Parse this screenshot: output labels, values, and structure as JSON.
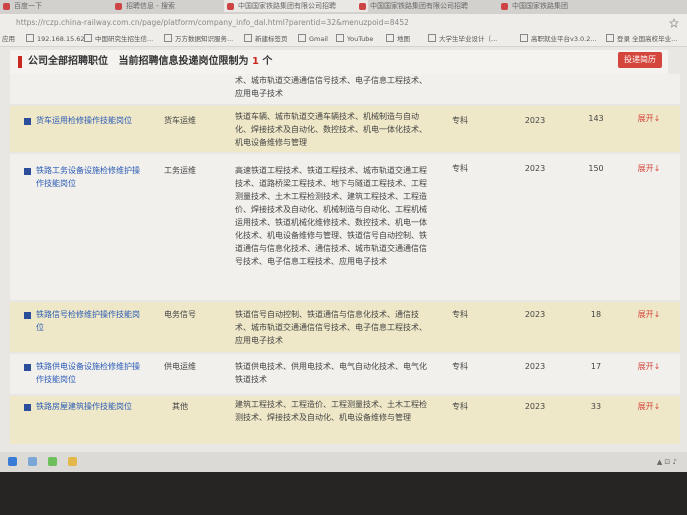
{
  "browser": {
    "tabs": [
      {
        "label": "百度一下"
      },
      {
        "label": "招聘信息 - 搜索"
      },
      {
        "label": "中国国家铁路集团有限公司招聘"
      },
      {
        "label": "中国国家铁路集团有限公司招聘"
      },
      {
        "label": "中国国家铁路集团"
      }
    ],
    "url": "https://rczp.china-railway.com.cn/page/platform/company_info_dal.html?parentid=32&menuzpoid=8452",
    "bookmarks": [
      {
        "label": "应用"
      },
      {
        "label": "192.168.15.62"
      },
      {
        "label": "中国研究生招生信..."
      },
      {
        "label": "万方数据知识服务..."
      },
      {
        "label": "新建标签页"
      },
      {
        "label": "Gmail"
      },
      {
        "label": "YouTube"
      },
      {
        "label": "地图"
      },
      {
        "label": "大学生毕业设计（..."
      },
      {
        "label": "高职就业平台v3.0.2..."
      },
      {
        "label": "登录 全国高校毕业..."
      }
    ]
  },
  "header": {
    "part1": "公司全部招聘职位",
    "part2": "当前招聘信息投递岗位限制为",
    "limit": "1",
    "unit": "个",
    "deliver_label": "投递简历"
  },
  "rows": [
    {
      "name": "",
      "category": "",
      "majors": "术、城市轨道交通通信信号技术、电子信息工程技术、应用电子技术",
      "education": "",
      "year": "",
      "count": "",
      "action": ""
    },
    {
      "name": "货车运用检修操作技能岗位",
      "category": "货车运维",
      "majors": "铁道车辆、城市轨道交通车辆技术、机械制造与自动化、焊接技术及自动化、数控技术、机电一体化技术、机电设备维修与管理",
      "education": "专科",
      "year": "2023",
      "count": "143",
      "action": "展开↓"
    },
    {
      "name": "铁路工务设备设施检修维护操作技能岗位",
      "category": "工务运维",
      "majors": "高速铁道工程技术、铁道工程技术、城市轨道交通工程技术、道路桥梁工程技术、地下与隧道工程技术、工程测量技术、土木工程检测技术、建筑工程技术、工程造价、焊接技术及自动化、机械制造与自动化、工程机械运用技术、铁道机械化维修技术、数控技术、机电一体化技术、机电设备维修与管理、铁道信号自动控制、铁道通信与信息化技术、通信技术、城市轨道交通通信信号技术、电子信息工程技术、应用电子技术",
      "education": "专科",
      "year": "2023",
      "count": "150",
      "action": "展开↓"
    },
    {
      "name": "铁路信号检修维护操作技能岗位",
      "category": "电务信号",
      "majors": "铁道信号自动控制、铁道通信与信息化技术、通信技术、城市轨道交通通信信号技术、电子信息工程技术、应用电子技术",
      "education": "专科",
      "year": "2023",
      "count": "18",
      "action": "展开↓"
    },
    {
      "name": "铁路供电设备设施检修维护操作技能岗位",
      "category": "供电运维",
      "majors": "铁道供电技术、供用电技术、电气自动化技术、电气化铁道技术",
      "education": "专科",
      "year": "2023",
      "count": "17",
      "action": "展开↓"
    },
    {
      "name": "铁路房屋建筑操作技能岗位",
      "category": "其他",
      "majors": "建筑工程技术、工程造价、工程测量技术、土木工程检测技术、焊接技术及自动化、机电设备维修与管理",
      "education": "专科",
      "year": "2023",
      "count": "33",
      "action": "展开↓"
    }
  ]
}
